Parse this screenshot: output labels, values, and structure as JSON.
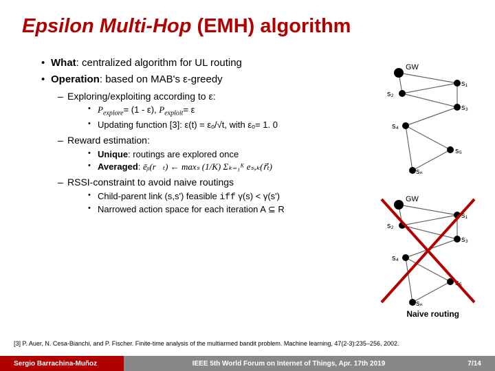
{
  "title": {
    "main": "Epsilon Multi-Hop",
    "suffix": "(EMH) algorithm"
  },
  "bullets": {
    "what": {
      "label": "What",
      "text": "centralized algorithm for UL routing"
    },
    "operation": {
      "label": "Operation",
      "text": "based on MAB's ε-greedy"
    }
  },
  "sub": {
    "explore": "Exploring/exploiting according to ε:",
    "pe": "(1 - ε)",
    "px": "ε",
    "update": "Updating function [3]: ε(t) = εₒ/√t, with εₒ= 1. 0",
    "reward": "Reward estimation:",
    "unique_label": "Unique",
    "unique_text": "routings are explored once",
    "avg_label": "Averaged",
    "avg_formula": "ēᵦ(r⃗ₜ) ← maxₛ (1/K) Σₖ₌₁ᴷ eₛ,ₖ(r⃗ₜ)",
    "rssi": "RSSI-constraint to avoid naive routings",
    "child_pre": "Child-parent link (s,s') feasible",
    "iff": "iff",
    "child_post": "γ(s) < γ(s')",
    "narrowed": "Narrowed action space for each iteration A ⊆ R"
  },
  "labels": {
    "naive": "Naive routing"
  },
  "diagram": {
    "nodes": [
      "GW",
      "s1",
      "s2",
      "s3",
      "s4",
      "s5",
      "s6"
    ]
  },
  "citation": "[3] P. Auer, N. Cesa-Bianchi, and P. Fischer. Finite-time analysis of the multiarmed bandit problem. Machine learning, 47(2-3):235–256, 2002.",
  "footer": {
    "author": "Sergio Barrachina-Muñoz",
    "venue": "IEEE 5th World Forum on Internet of Things, Apr. 17th 2019",
    "page": "7/14"
  }
}
